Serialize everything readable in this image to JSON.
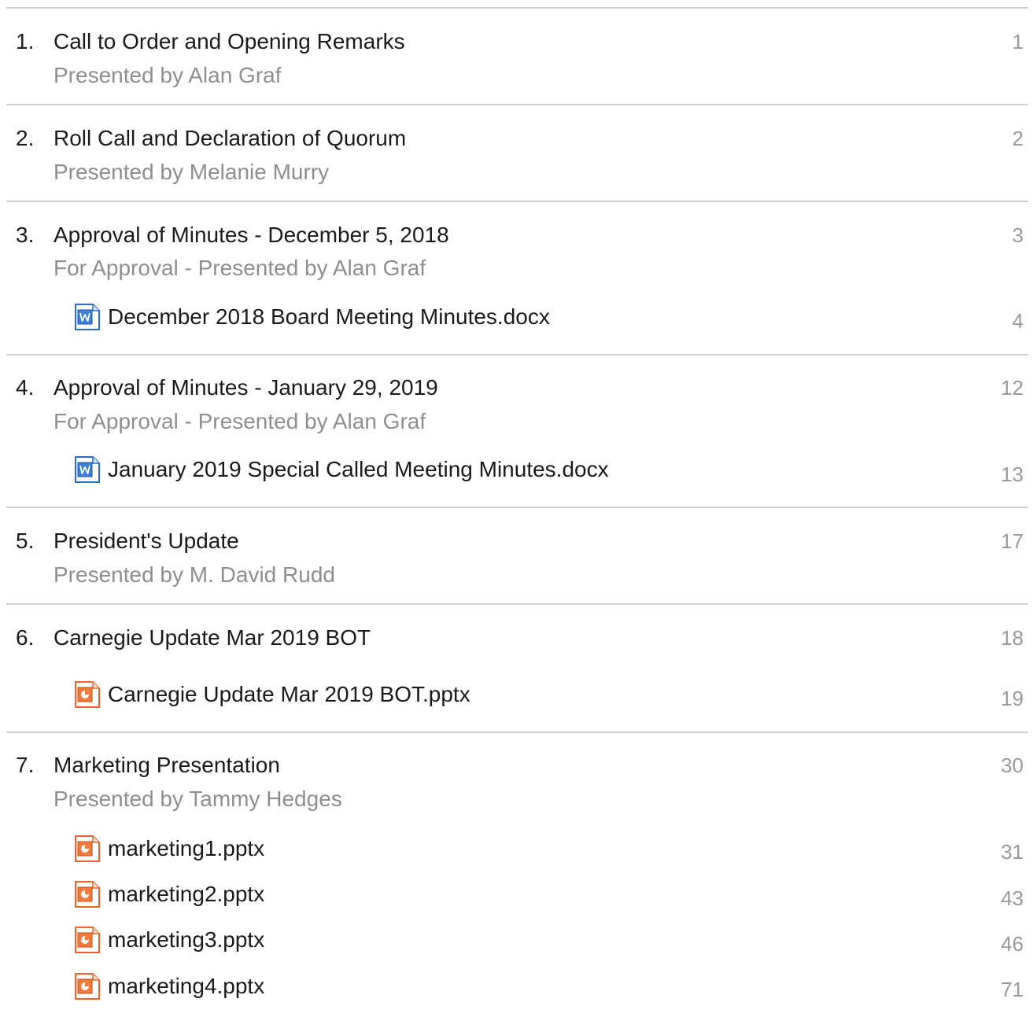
{
  "items": [
    {
      "number": "1.",
      "title": "Call to Order and Opening Remarks",
      "subtitle": "Presented by Alan Graf",
      "page": "1",
      "attachments": []
    },
    {
      "number": "2.",
      "title": "Roll Call and Declaration of Quorum",
      "subtitle": "Presented by Melanie Murry",
      "page": "2",
      "attachments": []
    },
    {
      "number": "3.",
      "title": "Approval of Minutes - December 5, 2018",
      "subtitle": "For Approval - Presented by Alan Graf",
      "page": "3",
      "attachments": [
        {
          "name": "December 2018 Board Meeting Minutes.docx",
          "page": "4",
          "icon": "word-document-icon"
        }
      ]
    },
    {
      "number": "4.",
      "title": "Approval of Minutes - January 29, 2019",
      "subtitle": "For Approval - Presented by Alan Graf",
      "page": "12",
      "attachments": [
        {
          "name": "January 2019 Special Called Meeting Minutes.docx",
          "page": "13",
          "icon": "word-document-icon"
        }
      ]
    },
    {
      "number": "5.",
      "title": "President's Update",
      "subtitle": "Presented by M. David Rudd",
      "page": "17",
      "attachments": []
    },
    {
      "number": "6.",
      "title": "Carnegie Update Mar 2019 BOT",
      "subtitle": "",
      "page": "18",
      "attachments": [
        {
          "name": "Carnegie Update Mar 2019 BOT.pptx",
          "page": "19",
          "icon": "powerpoint-document-icon"
        }
      ]
    },
    {
      "number": "7.",
      "title": "Marketing Presentation",
      "subtitle": "Presented by Tammy Hedges",
      "page": "30",
      "attachments": [
        {
          "name": "marketing1.pptx",
          "page": "31",
          "icon": "powerpoint-document-icon"
        },
        {
          "name": "marketing2.pptx",
          "page": "43",
          "icon": "powerpoint-document-icon"
        },
        {
          "name": "marketing3.pptx",
          "page": "46",
          "icon": "powerpoint-document-icon"
        },
        {
          "name": "marketing4.pptx",
          "page": "71",
          "icon": "powerpoint-document-icon"
        }
      ]
    }
  ],
  "colors": {
    "word_icon": "#2b6cc8",
    "powerpoint_icon": "#e8642a",
    "divider": "#d0d0d0",
    "secondary_text": "#8e8e8e",
    "page_number": "#9a9a9a"
  }
}
